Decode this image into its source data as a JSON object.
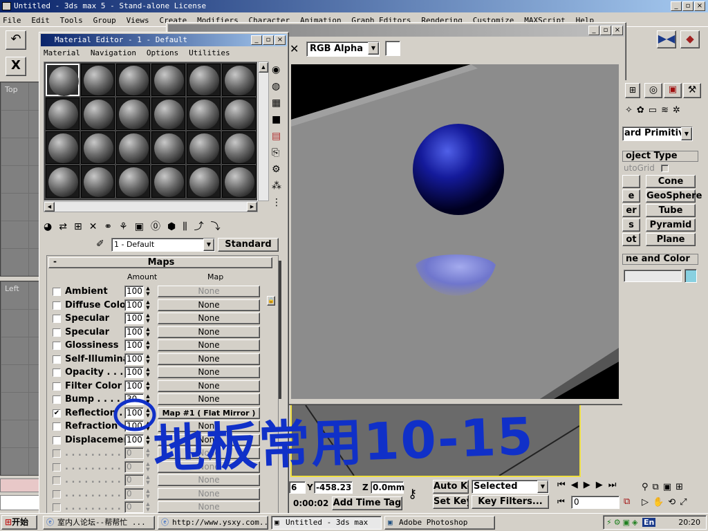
{
  "app": {
    "title": "Untitled - 3ds max 5 - Stand-alone License",
    "menu": [
      "File",
      "Edit",
      "Tools",
      "Group",
      "Views",
      "Create",
      "Modifiers",
      "Character",
      "Animation",
      "Graph Editors",
      "Rendering",
      "Customize",
      "MAXScript",
      "Help"
    ]
  },
  "viewports": {
    "top_label": "Top",
    "left_label": "Left"
  },
  "material_editor": {
    "title": "Material Editor - 1 - Default",
    "menu": [
      "Material",
      "Navigation",
      "Options",
      "Utilities"
    ],
    "material_name": "1 - Default",
    "material_type": "Standard",
    "maps_rollout_title": "Maps",
    "col_amount": "Amount",
    "col_map": "Map",
    "maps": [
      {
        "label": "Ambient",
        "amount": "100",
        "map": "None",
        "checked": false,
        "dim_map": true
      },
      {
        "label": "Diffuse Color",
        "amount": "100",
        "map": "None",
        "checked": false,
        "dim_map": false
      },
      {
        "label": "Specular",
        "amount": "100",
        "map": "None",
        "checked": false,
        "dim_map": false
      },
      {
        "label": "Specular",
        "amount": "100",
        "map": "None",
        "checked": false,
        "dim_map": false
      },
      {
        "label": "Glossiness",
        "amount": "100",
        "map": "None",
        "checked": false,
        "dim_map": false
      },
      {
        "label": "Self-Illuminat",
        "amount": "100",
        "map": "None",
        "checked": false,
        "dim_map": false
      },
      {
        "label": "Opacity . . . .",
        "amount": "100",
        "map": "None",
        "checked": false,
        "dim_map": false
      },
      {
        "label": "Filter Color .",
        "amount": "100",
        "map": "None",
        "checked": false,
        "dim_map": false
      },
      {
        "label": "Bump . . . .",
        "amount": "30",
        "map": "None",
        "checked": false,
        "dim_map": false
      },
      {
        "label": "Reflection .",
        "amount": "100",
        "map": "Map #1 ( Flat Mirror )",
        "checked": true,
        "dim_map": false
      },
      {
        "label": "Refraction",
        "amount": "100",
        "map": "None",
        "checked": false,
        "dim_map": false
      },
      {
        "label": "Displacemen",
        "amount": "100",
        "map": "None",
        "checked": false,
        "dim_map": false
      },
      {
        "label": ". . . . . . . . .",
        "amount": "0",
        "map": "None",
        "checked": false,
        "dim_map": true
      },
      {
        "label": ". . . . . . . . .",
        "amount": "0",
        "map": "None",
        "checked": false,
        "dim_map": true
      },
      {
        "label": ". . . . . . . . .",
        "amount": "0",
        "map": "None",
        "checked": false,
        "dim_map": true
      },
      {
        "label": ". . . . . . . . .",
        "amount": "0",
        "map": "None",
        "checked": false,
        "dim_map": true
      },
      {
        "label": ". . . . . . . . .",
        "amount": "0",
        "map": "None",
        "checked": false,
        "dim_map": true
      }
    ]
  },
  "render_window": {
    "channel": "RGB Alpha"
  },
  "command_panel": {
    "dropdown": "ard Primitive",
    "object_type_title": "oject Type",
    "autogrid": "utoGrid",
    "buttons_left": [
      "",
      "e",
      "er",
      "s",
      "ot"
    ],
    "buttons_right": [
      "Cone",
      "GeoSphere",
      "Tube",
      "Pyramid",
      "Plane"
    ],
    "name_color_title": "ne and Color"
  },
  "status": {
    "x_value": "6",
    "y_value": "-458.23",
    "z_value": "0.0mm",
    "time": "0:00:02",
    "add_time_tag": "Add Time Tag",
    "auto_key": "Auto Key",
    "set_key": "Set Key",
    "selected": "Selected",
    "key_filters": "Key Filters...",
    "frame": "0"
  },
  "annotation": {
    "text": "地板常用10-15"
  },
  "taskbar": {
    "start": "开始",
    "tasks": [
      "室内人论坛--帮帮忙 ...",
      "http://www.ysxy.com...",
      "Untitled - 3ds max",
      "Adobe Photoshop"
    ],
    "clock": "20:20",
    "ime": "En"
  }
}
